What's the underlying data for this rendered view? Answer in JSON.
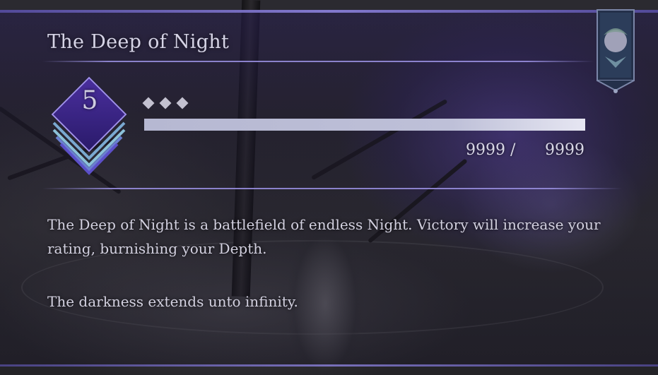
{
  "panel": {
    "title": "The Deep of Night",
    "depth_level": "5",
    "progress": {
      "pips_count": 3,
      "fill_fraction": 1.0,
      "current": "9999 /",
      "max": "9999"
    },
    "description": "The Deep of Night is a battlefield of endless Night. Victory will increase your rating, burnishing your Depth.",
    "flavor": "The darkness extends unto infinity."
  },
  "colors": {
    "accent_purple": "#8c82dc",
    "bar_fill": "#bec0d8",
    "text": "#d6d4e6"
  },
  "icons": {
    "banner": "night-banner-icon",
    "badge": "depth-rank-badge-icon",
    "pip": "diamond-pip-icon"
  }
}
